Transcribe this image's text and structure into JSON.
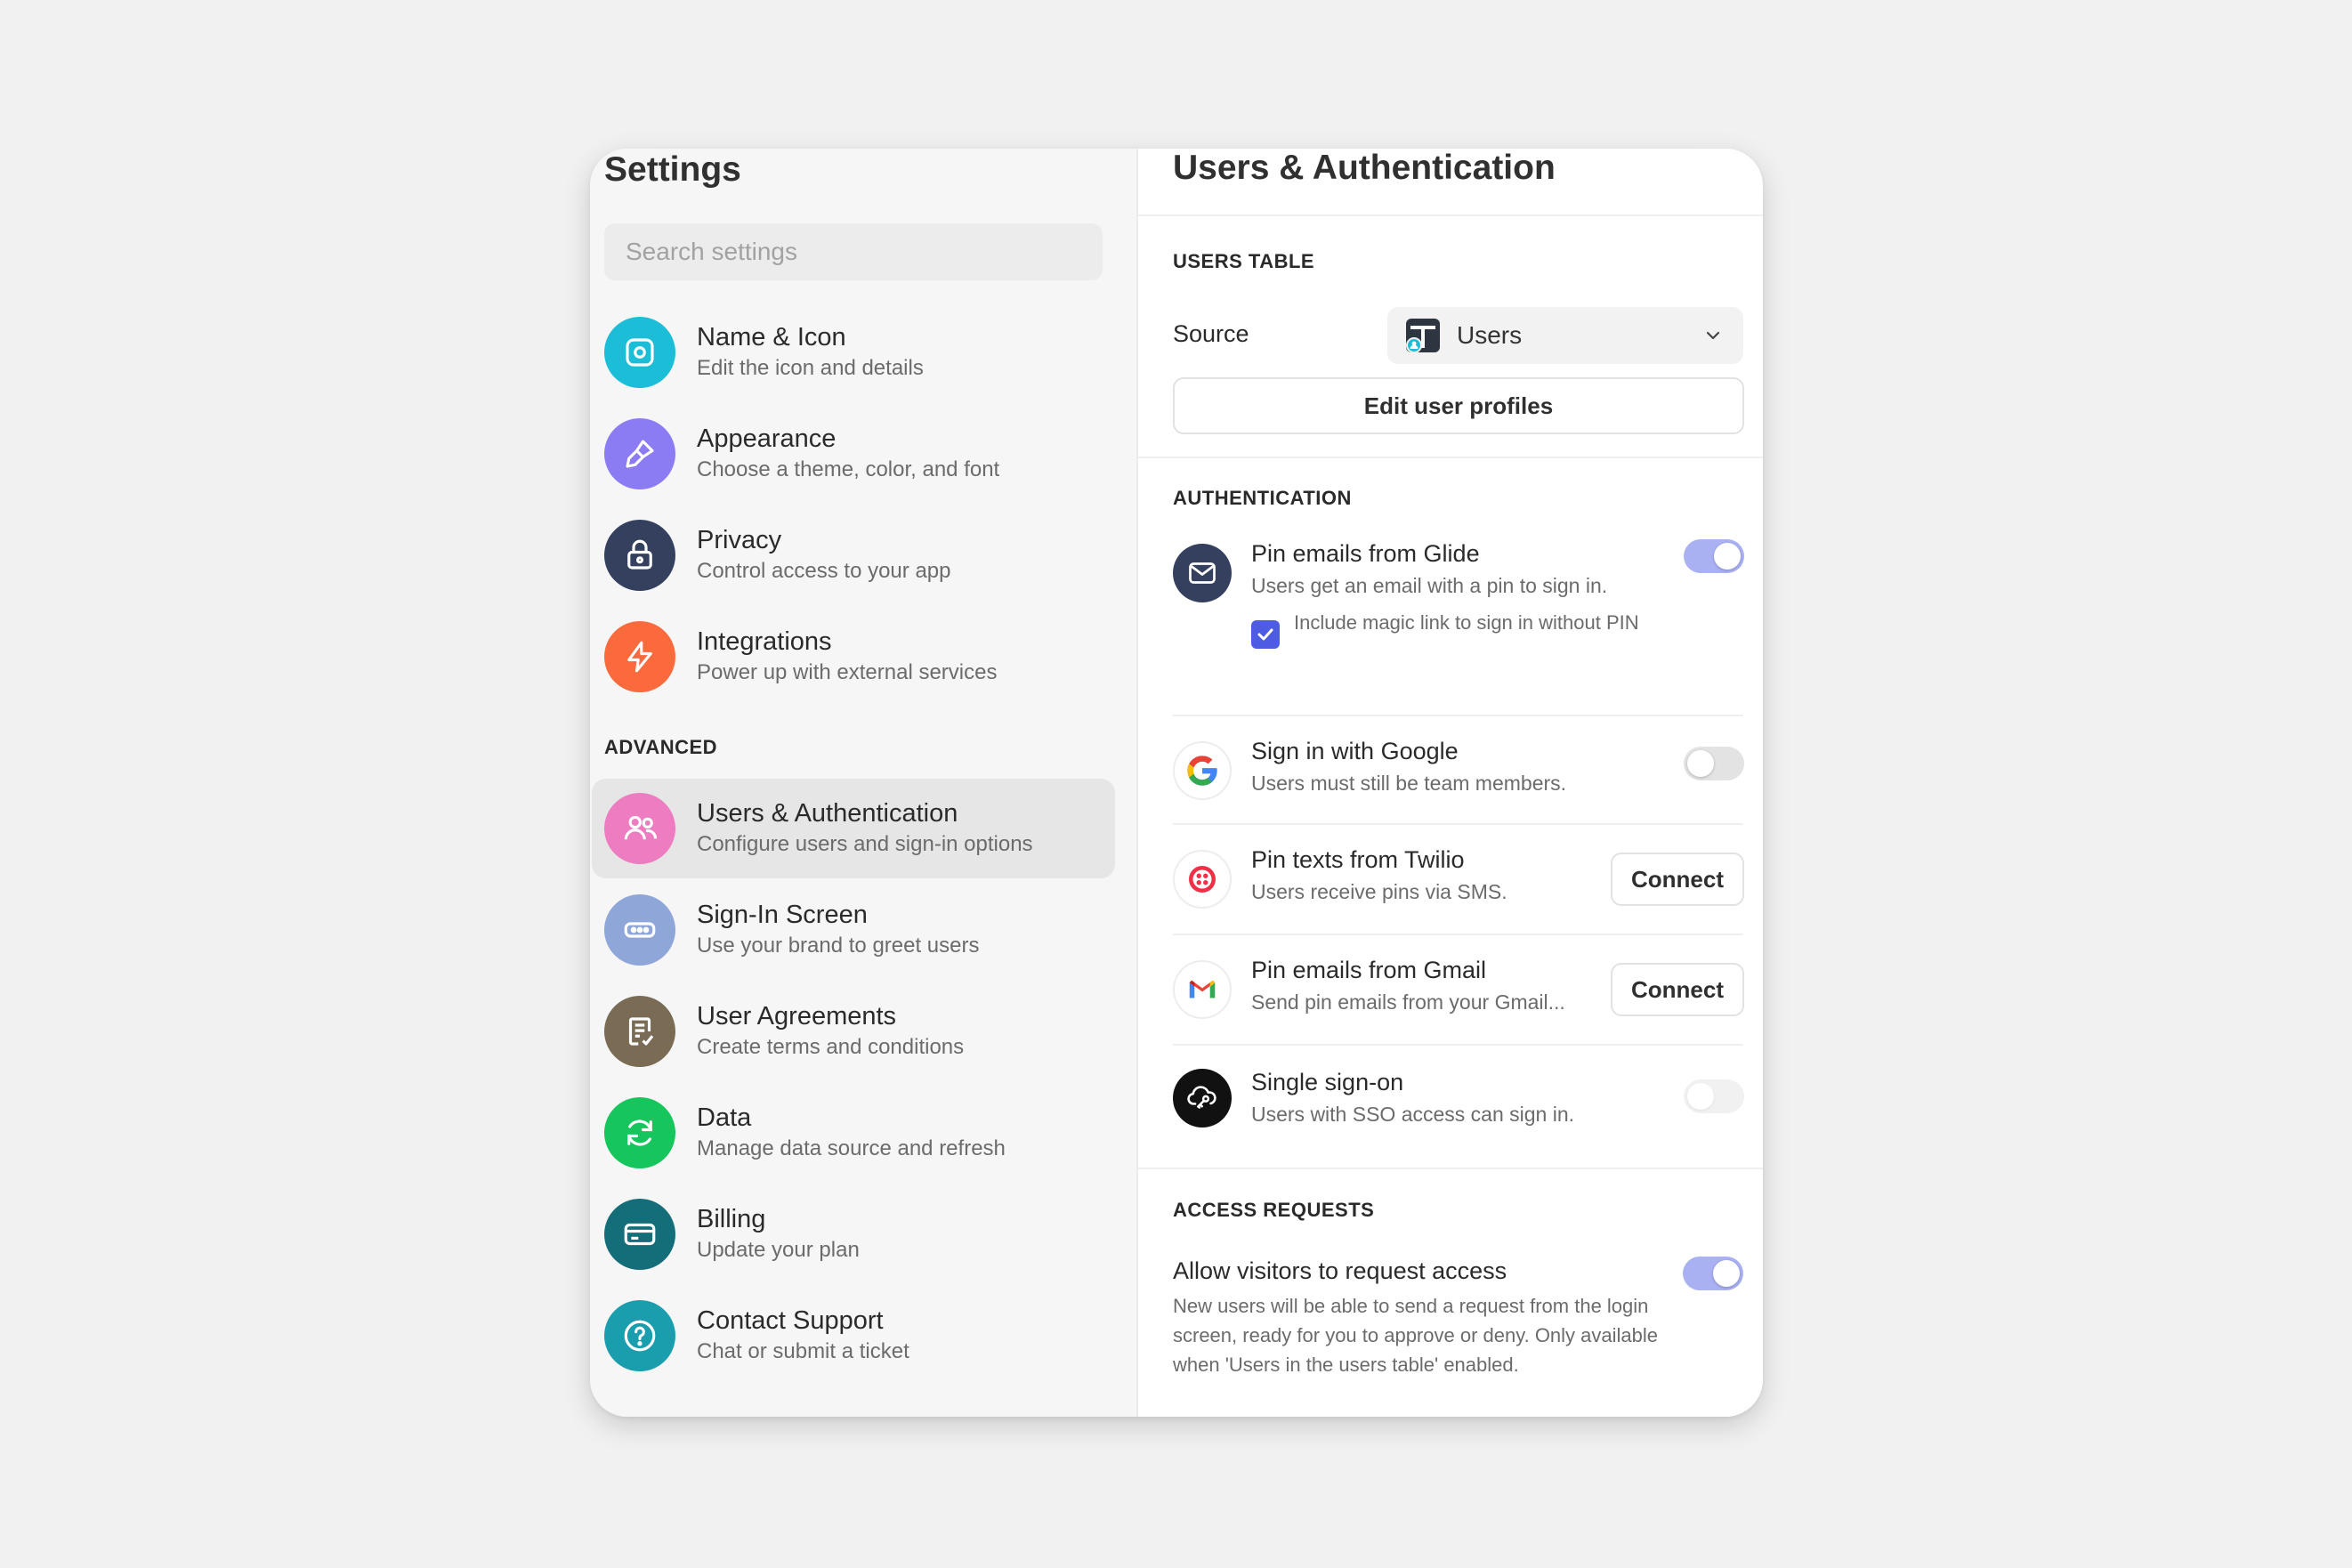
{
  "sidebar": {
    "title": "Settings",
    "search_placeholder": "Search settings",
    "advanced_label": "ADVANCED",
    "items": [
      {
        "label": "Name & Icon",
        "sub": "Edit the icon and details",
        "icon": "name-icon",
        "color": "#1cbdd6"
      },
      {
        "label": "Appearance",
        "sub": "Choose a theme, color, and font",
        "icon": "brush-icon",
        "color": "#8c7cf4"
      },
      {
        "label": "Privacy",
        "sub": "Control access to your app",
        "icon": "lock-icon",
        "color": "#34405e"
      },
      {
        "label": "Integrations",
        "sub": "Power up with external services",
        "icon": "lightning-icon",
        "color": "#fb6a3d"
      },
      {
        "label": "Users & Authentication",
        "sub": "Configure users and sign-in options",
        "icon": "users-icon",
        "color": "#ee7cc0",
        "active": true
      },
      {
        "label": "Sign-In Screen",
        "sub": "Use your brand to greet users",
        "icon": "password-field-icon",
        "color": "#8ea6d8"
      },
      {
        "label": "User Agreements",
        "sub": "Create terms and conditions",
        "icon": "document-check-icon",
        "color": "#7a6b55"
      },
      {
        "label": "Data",
        "sub": "Manage data source and refresh",
        "icon": "refresh-icon",
        "color": "#16c55b"
      },
      {
        "label": "Billing",
        "sub": "Update your plan",
        "icon": "credit-card-icon",
        "color": "#136e7a"
      },
      {
        "label": "Contact Support",
        "sub": "Chat or submit a ticket",
        "icon": "help-icon",
        "color": "#1a9eae"
      }
    ]
  },
  "main": {
    "title": "Users & Authentication",
    "users_table": {
      "heading": "USERS TABLE",
      "source_label": "Source",
      "source_value": "Users",
      "edit_button": "Edit user profiles"
    },
    "authentication": {
      "heading": "AUTHENTICATION",
      "pin_glide": {
        "title": "Pin emails from Glide",
        "sub": "Users get an email with a pin to sign in.",
        "enabled": true,
        "checkbox_label": "Include magic link to sign in without PIN",
        "checkbox_checked": true
      },
      "google": {
        "title": "Sign in with Google",
        "sub": "Users must still be team members.",
        "enabled": false
      },
      "twilio": {
        "title": "Pin texts from Twilio",
        "sub": "Users receive pins via SMS.",
        "button": "Connect"
      },
      "gmail": {
        "title": "Pin emails from Gmail",
        "sub": "Send pin emails from your Gmail...",
        "button": "Connect"
      },
      "sso": {
        "title": "Single sign-on",
        "sub": "Users with SSO access can sign in.",
        "enabled": false,
        "disabled": true
      }
    },
    "access_requests": {
      "heading": "ACCESS REQUESTS",
      "title": "Allow visitors to request access",
      "description": "New users will be able to send a request from the login screen, ready for you to approve or deny. Only available when 'Users in the users table' enabled.",
      "enabled": true
    }
  },
  "colors": {
    "accent": "#4e5ce4",
    "toggle_on": "#aab1f3",
    "background": "#f1f1f1"
  }
}
